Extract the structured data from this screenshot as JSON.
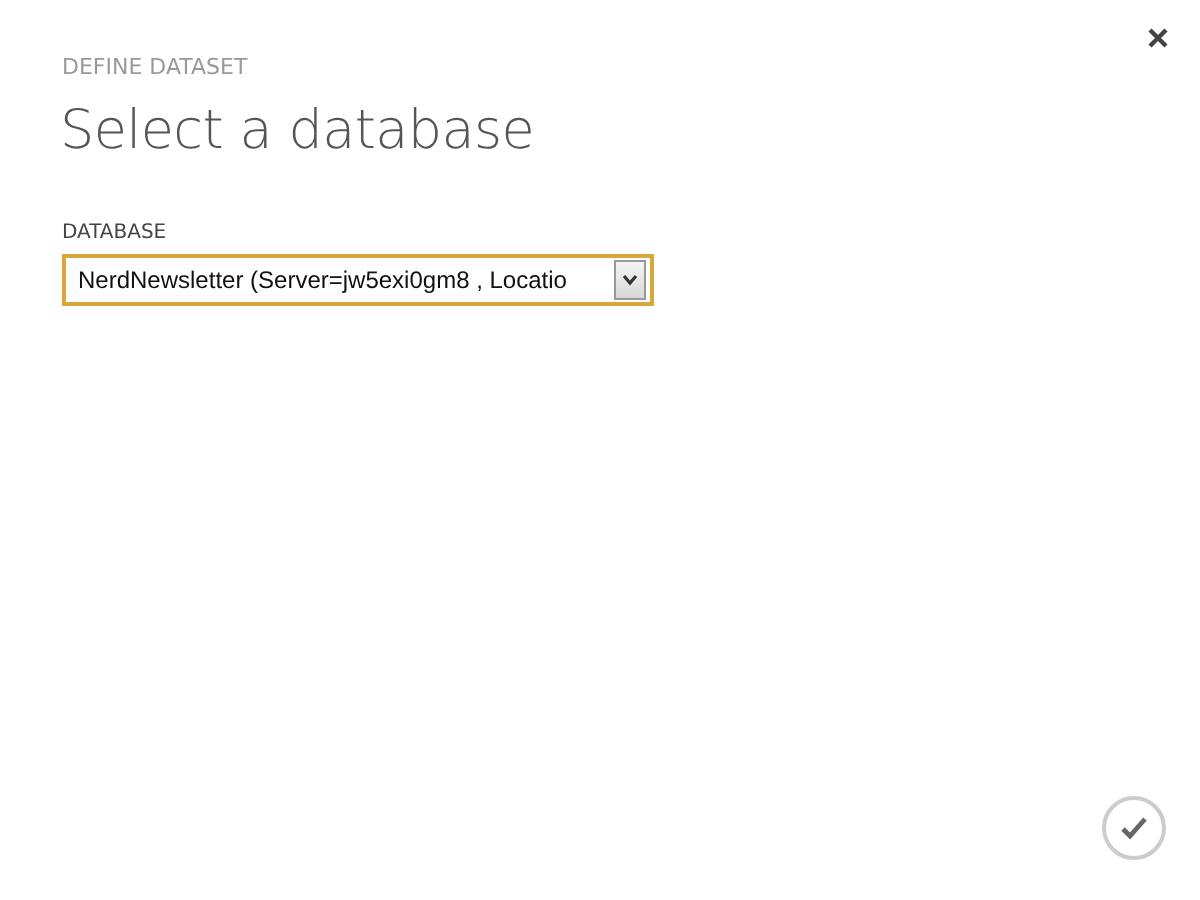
{
  "dialog": {
    "kicker": "DEFINE DATASET",
    "title": "Select a database"
  },
  "database": {
    "label": "DATABASE",
    "value": "NerdNewsletter (Server=jw5exi0gm8 , Locatio"
  }
}
